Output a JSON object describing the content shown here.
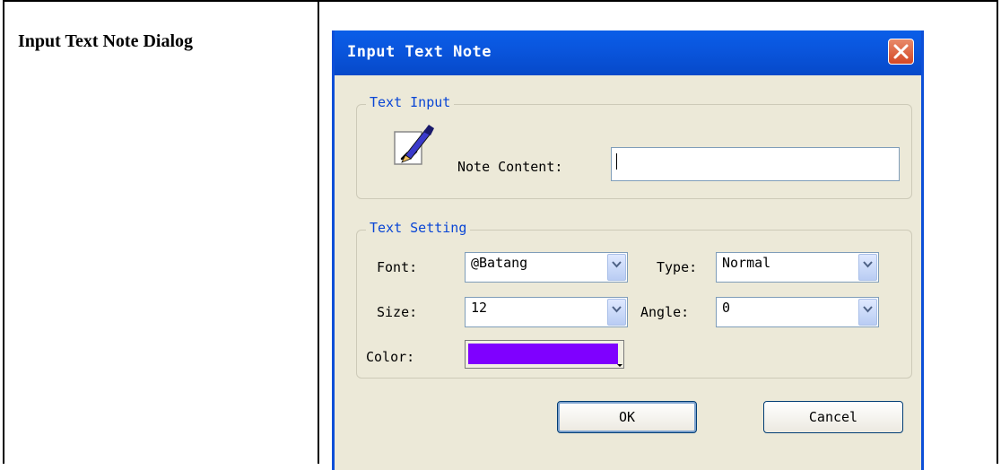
{
  "document": {
    "caption": "Input Text Note Dialog"
  },
  "dialog": {
    "title": "Input Text Note",
    "text_input_group": {
      "legend": "Text Input",
      "note_content_label": "Note Content:",
      "note_content_value": ""
    },
    "text_setting_group": {
      "legend": "Text Setting",
      "font_label": "Font:",
      "font_value": "@Batang",
      "type_label": "Type:",
      "type_value": "Normal",
      "size_label": "Size:",
      "size_value": "12",
      "angle_label": "Angle:",
      "angle_value": "0",
      "color_label": "Color:",
      "color_value": "#7f00ff"
    },
    "ok_label": "OK",
    "cancel_label": "Cancel"
  },
  "colors": {
    "titlebar": "#0a5ee8",
    "dialog_bg": "#ece9d8",
    "legend_text": "#0a46d5",
    "close_button": "#d44726"
  },
  "icons": [
    "note-pen-icon",
    "close-icon",
    "chevron-down-icon"
  ]
}
